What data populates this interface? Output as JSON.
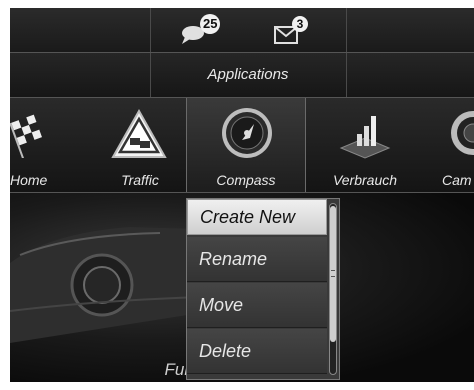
{
  "status": {
    "messages_count": "25",
    "mail_count": "3",
    "messages_icon": "speech-bubble-icon",
    "mail_icon": "envelope-icon"
  },
  "title": "Applications",
  "apps": [
    {
      "label": "Home",
      "icon": "checkered-flag-icon"
    },
    {
      "label": "Traffic",
      "icon": "traffic-warning-icon"
    },
    {
      "label": "Compass",
      "icon": "compass-icon"
    },
    {
      "label": "Verbrauch",
      "icon": "consumption-chart-icon"
    },
    {
      "label": "Cam",
      "icon": "camera-icon"
    }
  ],
  "menu": {
    "items": [
      "Create New",
      "Rename",
      "Move",
      "Delete"
    ],
    "selected": "Create New"
  },
  "footer_label": "Fullscreen Compass",
  "colors": {
    "screen_bg": "#0b0b0b",
    "highlight": "#e6e6e6",
    "text": "#e8e8e8"
  }
}
